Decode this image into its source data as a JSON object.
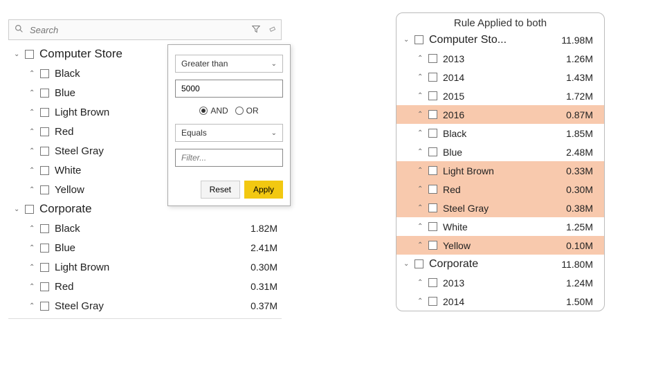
{
  "search": {
    "placeholder": "Search"
  },
  "left_tree": {
    "groups": [
      {
        "label": "Computer Store",
        "items": [
          {
            "label": "Black",
            "value": ""
          },
          {
            "label": "Blue",
            "value": ""
          },
          {
            "label": "Light Brown",
            "value": ""
          },
          {
            "label": "Red",
            "value": ""
          },
          {
            "label": "Steel Gray",
            "value": ""
          },
          {
            "label": "White",
            "value": ""
          },
          {
            "label": "Yellow",
            "value": ""
          }
        ]
      },
      {
        "label": "Corporate",
        "items": [
          {
            "label": "Black",
            "value": "1.82M"
          },
          {
            "label": "Blue",
            "value": "2.41M"
          },
          {
            "label": "Light Brown",
            "value": "0.30M"
          },
          {
            "label": "Red",
            "value": "0.31M"
          },
          {
            "label": "Steel Gray",
            "value": "0.37M"
          }
        ]
      }
    ]
  },
  "popup": {
    "op1": "Greater than",
    "value1": "5000",
    "and_label": "AND",
    "or_label": "OR",
    "op2": "Equals",
    "value2_placeholder": "Filter...",
    "reset_label": "Reset",
    "apply_label": "Apply"
  },
  "right": {
    "title": "Rule Applied to both",
    "groups": [
      {
        "label": "Computer Sto...",
        "value": "11.98M",
        "items": [
          {
            "label": "2013",
            "value": "1.26M",
            "hl": false
          },
          {
            "label": "2014",
            "value": "1.43M",
            "hl": false
          },
          {
            "label": "2015",
            "value": "1.72M",
            "hl": false
          },
          {
            "label": "2016",
            "value": "0.87M",
            "hl": true
          },
          {
            "label": "Black",
            "value": "1.85M",
            "hl": false
          },
          {
            "label": "Blue",
            "value": "2.48M",
            "hl": false
          },
          {
            "label": "Light Brown",
            "value": "0.33M",
            "hl": true
          },
          {
            "label": "Red",
            "value": "0.30M",
            "hl": true
          },
          {
            "label": "Steel Gray",
            "value": "0.38M",
            "hl": true
          },
          {
            "label": "White",
            "value": "1.25M",
            "hl": false
          },
          {
            "label": "Yellow",
            "value": "0.10M",
            "hl": true
          }
        ]
      },
      {
        "label": "Corporate",
        "value": "11.80M",
        "items": [
          {
            "label": "2013",
            "value": "1.24M",
            "hl": false
          },
          {
            "label": "2014",
            "value": "1.50M",
            "hl": false
          }
        ]
      }
    ]
  }
}
